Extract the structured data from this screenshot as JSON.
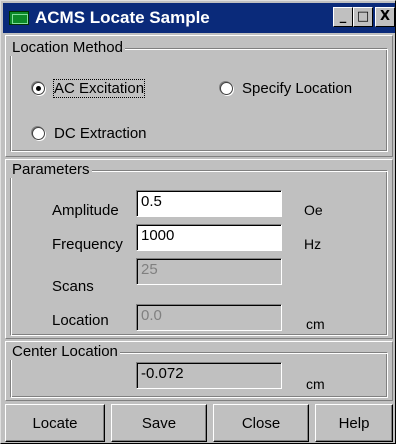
{
  "window": {
    "title": "ACMS Locate Sample",
    "minimize_glyph": "_",
    "maximize_glyph": "□",
    "close_glyph": "X"
  },
  "location_method": {
    "legend": "Location Method",
    "options": [
      {
        "label": "AC Excitation",
        "checked": true
      },
      {
        "label": "Specify Location",
        "checked": false
      },
      {
        "label": "DC Extraction",
        "checked": false
      }
    ]
  },
  "parameters": {
    "legend": "Parameters",
    "amplitude": {
      "label": "Amplitude",
      "value": "0.5",
      "unit": "Oe"
    },
    "frequency": {
      "label": "Frequency",
      "value": "1000",
      "unit": "Hz"
    },
    "scans": {
      "label": "Scans",
      "value": "25"
    },
    "location": {
      "label": "Location",
      "value": "0.0",
      "unit": "cm"
    }
  },
  "center_location": {
    "legend": "Center Location",
    "value": "-0.072",
    "unit": "cm"
  },
  "buttons": {
    "locate": "Locate",
    "save": "Save",
    "close": "Close",
    "help": "Help"
  }
}
